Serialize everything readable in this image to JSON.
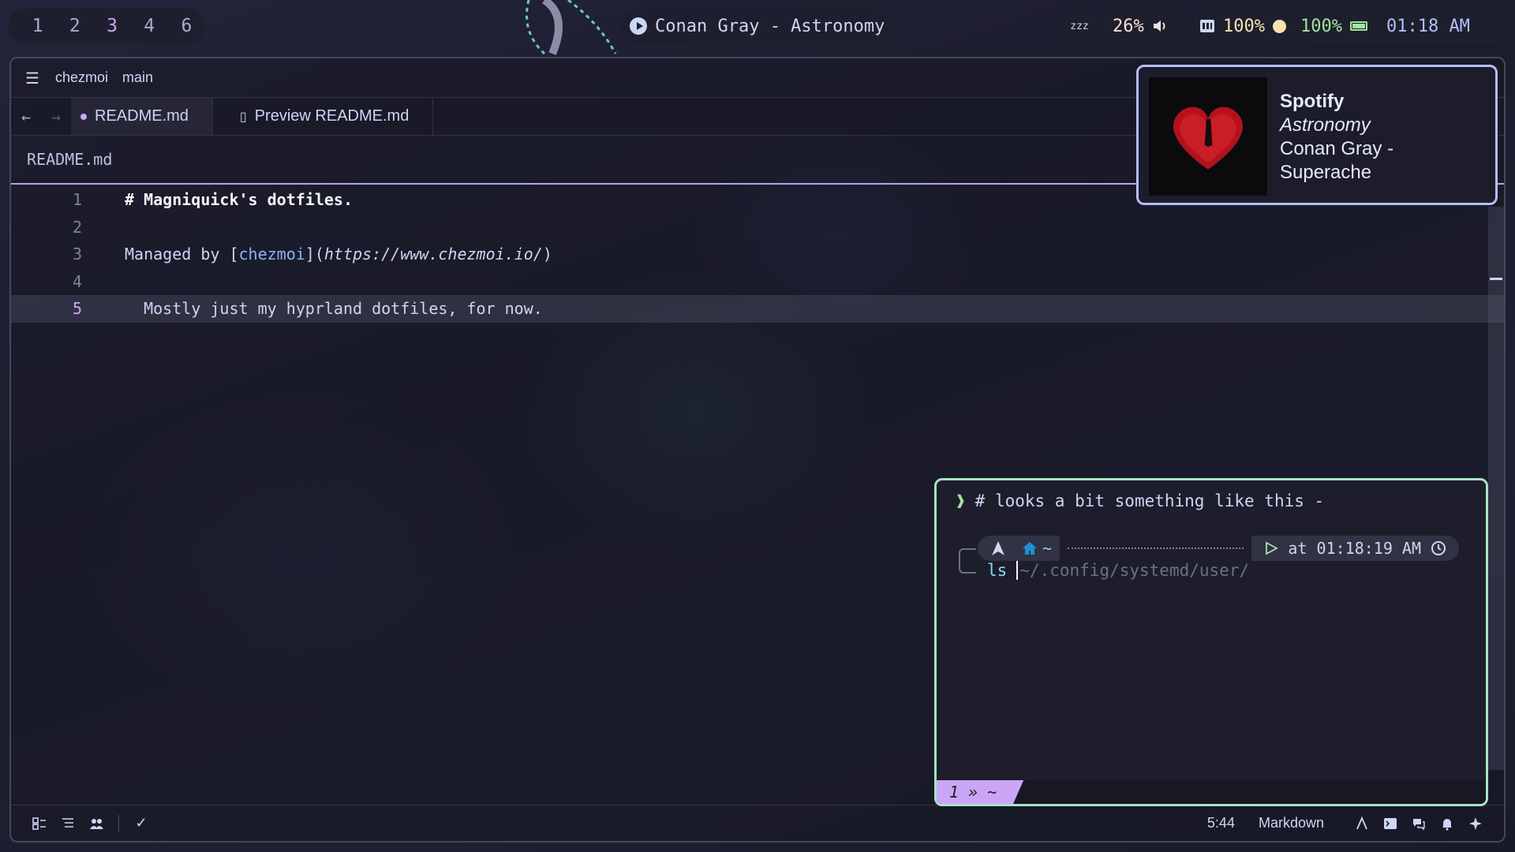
{
  "topbar": {
    "workspaces": [
      {
        "label": "1",
        "active": false
      },
      {
        "label": "2",
        "active": false
      },
      {
        "label": "3",
        "active": true
      },
      {
        "label": "4",
        "active": false
      },
      {
        "label": "6",
        "active": false
      }
    ],
    "media_title": "Conan Gray - Astronomy",
    "idle_icon": "zzz",
    "volume": "26%",
    "brightness": "100%",
    "battery": "100%",
    "clock": "01:18 AM",
    "accent": "#cba6f7"
  },
  "editor": {
    "title_left": "chezmoi",
    "title_branch": "main",
    "tabs": [
      {
        "label": "README.md",
        "modified": true
      },
      {
        "label": "Preview README.md"
      }
    ],
    "breadcrumb": "README.md",
    "lines": [
      {
        "n": "1",
        "h1": "# Magniquick's dotfiles."
      },
      {
        "n": "2"
      },
      {
        "n": "3",
        "pre": "Managed by [",
        "link": "chezmoi",
        "mid": "](",
        "url": "https://www.chezmoi.io/",
        "post": ")"
      },
      {
        "n": "4"
      },
      {
        "n": "5",
        "text": "  Mostly just my hyprland dotfiles, for now."
      }
    ],
    "status": {
      "cursor_pos": "5:44",
      "language": "Markdown"
    }
  },
  "notification": {
    "app": "Spotify",
    "summary": "Astronomy",
    "body": "Conan Gray - Superache"
  },
  "terminal": {
    "comment_line": "# looks a bit something like this -",
    "prompt_home": "~",
    "prompt_time": "at 01:18:19 AM",
    "command": "ls",
    "suggestion": "~/.config/systemd/user/",
    "tmux_status": "1 » ~"
  }
}
